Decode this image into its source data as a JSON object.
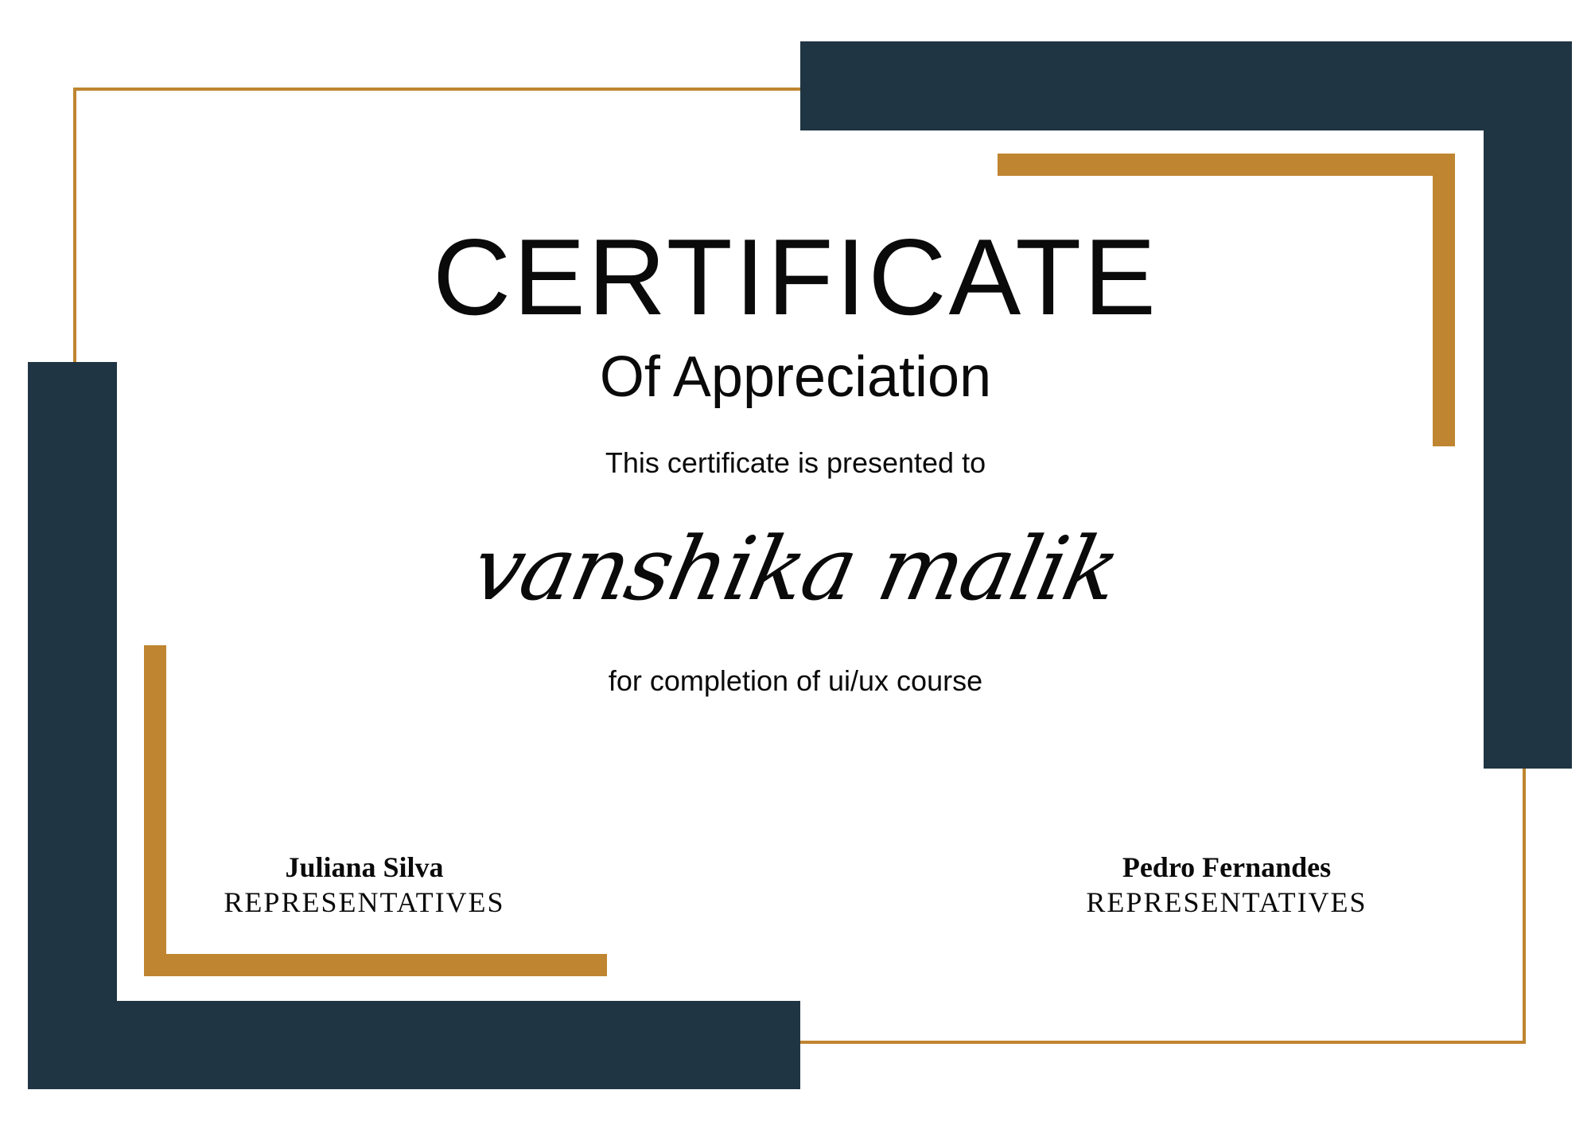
{
  "certificate": {
    "title": "CERTIFICATE",
    "subtitle": "Of Appreciation",
    "presented_text": "This certificate is presented to",
    "recipient_name": "vanshika malik",
    "reason": "for completion of ui/ux course"
  },
  "signatures": [
    {
      "name": "Juliana Silva",
      "role": "REPRESENTATIVES"
    },
    {
      "name": "Pedro Fernandes",
      "role": "REPRESENTATIVES"
    }
  ],
  "colors": {
    "navy": "#203543",
    "gold": "#bf8530",
    "background": "#ffffff",
    "text": "#0a0a0a"
  }
}
